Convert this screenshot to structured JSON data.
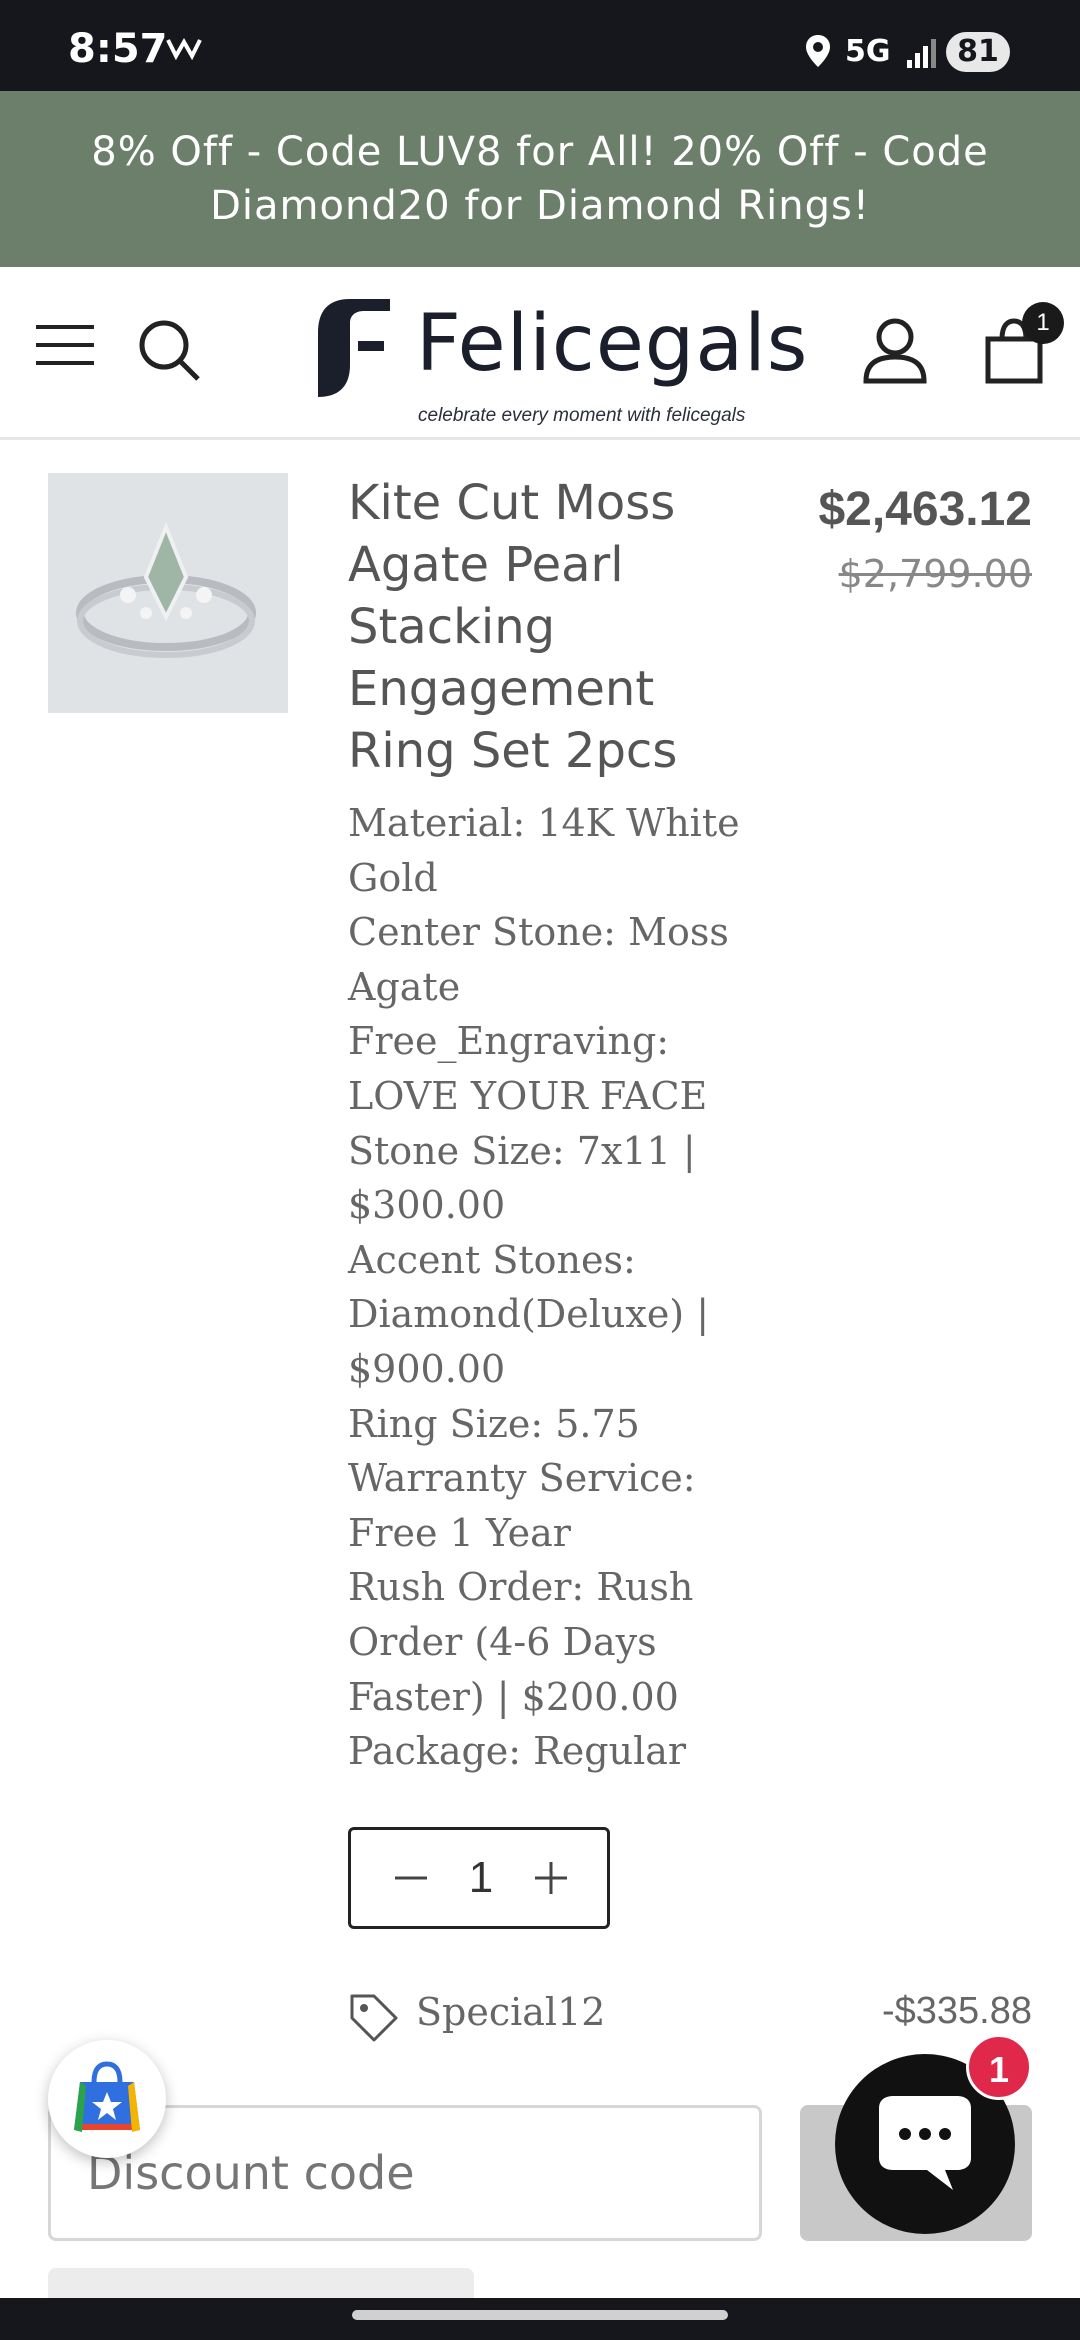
{
  "status_bar": {
    "time": "8:57",
    "network": "5G",
    "battery": "81"
  },
  "promo": {
    "text": "8% Off - Code LUV8 for All! 20% Off - Code Diamond20 for Diamond Rings!"
  },
  "header": {
    "logo_name": "Felicegals",
    "logo_tagline": "celebrate every moment with felicegals",
    "cart_count": "1"
  },
  "cart_item": {
    "title": "Kite Cut Moss Agate Pearl Stacking Engagement Ring Set 2pcs",
    "price": "$2,463.12",
    "compare_price": "$2,799.00",
    "properties": [
      "Material: 14K White Gold",
      "Center Stone: Moss Agate",
      "Free_Engraving: LOVE YOUR FACE",
      "Stone Size: 7x11 | $300.00",
      "Accent Stones: Diamond(Deluxe) | $900.00",
      "Ring Size: 5.75",
      "Warranty Service: Free 1 Year",
      "Rush Order: Rush Order (4-6 Days Faster) | $200.00",
      "Package: Regular"
    ],
    "quantity": "1",
    "discount_code": "Special12",
    "discount_amount": "-$335.88"
  },
  "discount": {
    "placeholder": "Discount code"
  },
  "chat": {
    "badge": "1"
  },
  "colors": {
    "promo_bg": "#6b7f6b",
    "chat_bg": "#111111",
    "badge": "#e0284a"
  }
}
